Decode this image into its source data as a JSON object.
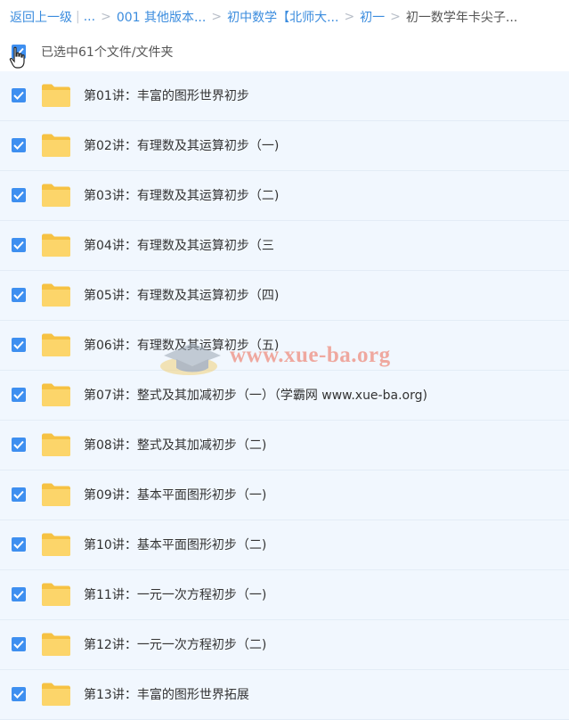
{
  "breadcrumb": {
    "back": "返回上一级",
    "ellipsis": "...",
    "items": [
      "001 其他版本...",
      "初中数学【北师大...",
      "初一"
    ],
    "current": "初一数学年卡尖子..."
  },
  "selection": {
    "text": "已选中61个文件/文件夹"
  },
  "files": [
    {
      "name": "第01讲：丰富的图形世界初步",
      "checked": true
    },
    {
      "name": "第02讲：有理数及其运算初步（一)",
      "checked": true
    },
    {
      "name": "第03讲：有理数及其运算初步（二)",
      "checked": true
    },
    {
      "name": "第04讲：有理数及其运算初步（三",
      "checked": true
    },
    {
      "name": "第05讲：有理数及其运算初步（四)",
      "checked": true
    },
    {
      "name": "第06讲：有理数及其运算初步（五)",
      "checked": true
    },
    {
      "name": "第07讲：整式及其加减初步（一）（学霸网 www.xue-ba.org)",
      "checked": true
    },
    {
      "name": "第08讲：整式及其加减初步（二)",
      "checked": true
    },
    {
      "name": "第09讲：基本平面图形初步（一)",
      "checked": true
    },
    {
      "name": "第10讲：基本平面图形初步（二)",
      "checked": true
    },
    {
      "name": "第11讲：一元一次方程初步（一)",
      "checked": true
    },
    {
      "name": "第12讲：一元一次方程初步（二)",
      "checked": true
    },
    {
      "name": "第13讲：丰富的图形世界拓展",
      "checked": true
    }
  ],
  "watermark": {
    "text": "www.xue-ba.org"
  },
  "colors": {
    "link": "#3b8cde",
    "checkbox": "#3e8ff0",
    "row_bg": "#f1f7fe",
    "folder": "#fcd56a"
  }
}
